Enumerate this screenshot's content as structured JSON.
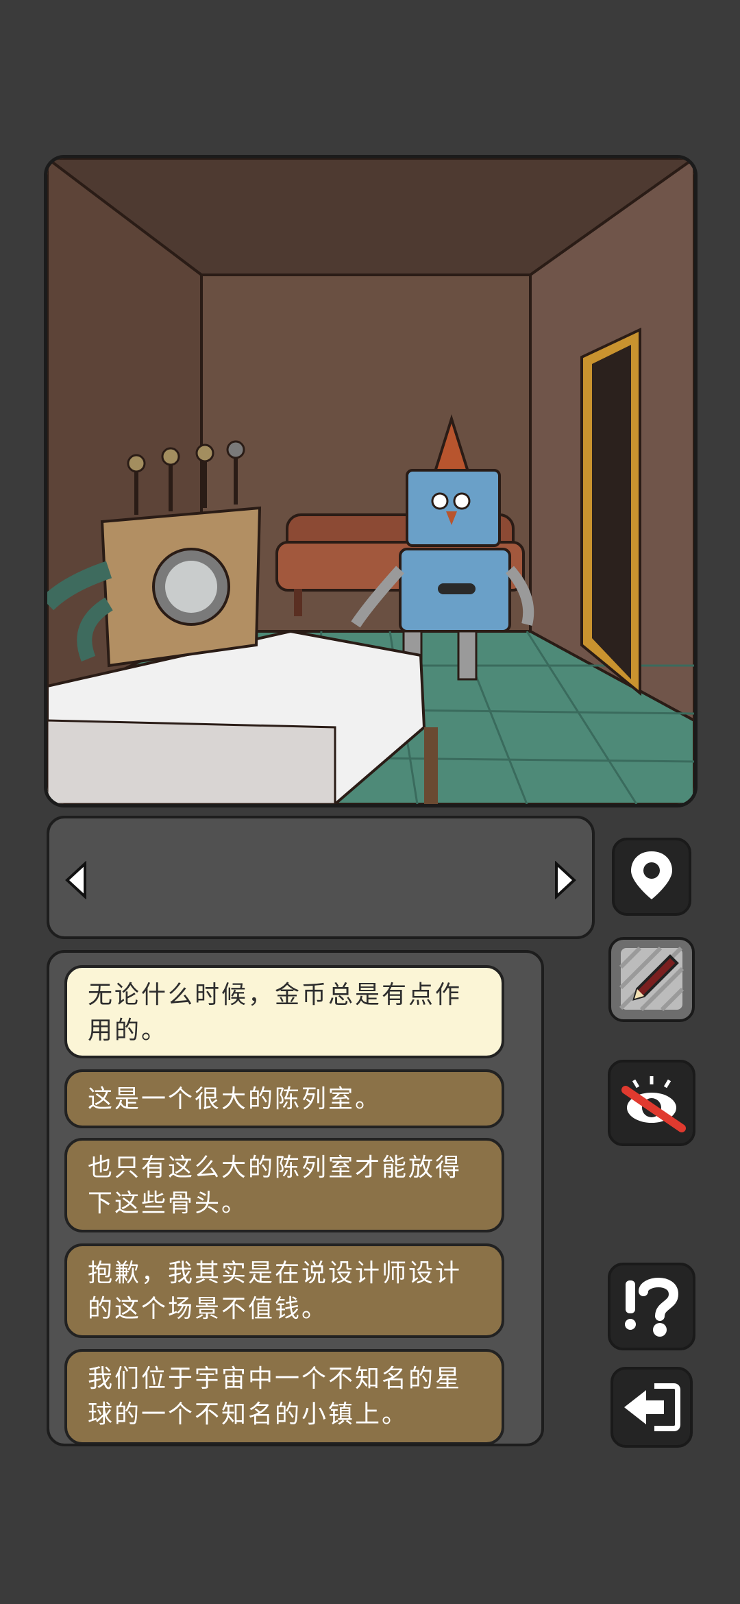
{
  "dialog": {
    "lines": [
      "无论什么时候，金币总是有点作用的。",
      "这是一个很大的陈列室。",
      "也只有这么大的陈列室才能放得下这些骨头。",
      "抱歉，我其实是在说设计师设计的这个场景不值钱。",
      "我们位于宇宙中一个不知名的星球的一个不知名的小镇上。"
    ],
    "active_index": 0
  },
  "icons": {
    "inventory_prev": "triangle-left-icon",
    "inventory_next": "triangle-right-icon",
    "map": "map-pin-icon",
    "notes": "pencil-icon",
    "hide_view": "eye-crossed-icon",
    "hint": "question-exclamation-icon",
    "back": "back-arrow-icon"
  },
  "colors": {
    "background": "#3b3b3b",
    "panel": "#515151",
    "dialog_item": "#8b7248",
    "dialog_active": "#fbf5d6",
    "strike_red": "#e03a2f"
  }
}
